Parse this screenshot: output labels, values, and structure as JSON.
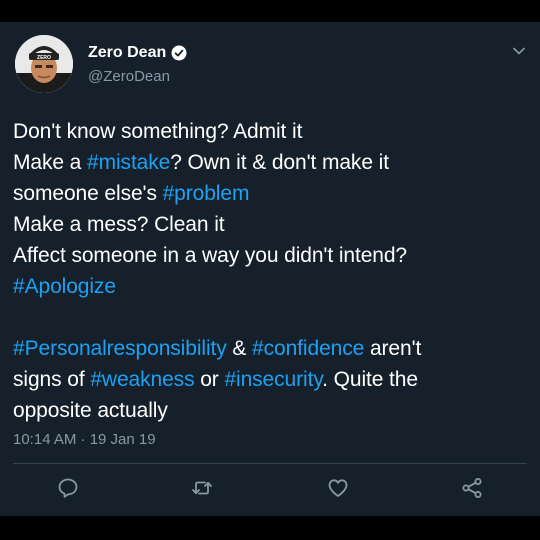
{
  "user": {
    "display_name": "Zero Dean",
    "handle": "@ZeroDean",
    "avatar_cap_text": "ZERO"
  },
  "tweet": {
    "lines": [
      [
        {
          "t": "Don't know something? Admit it"
        }
      ],
      [
        {
          "t": "Make a "
        },
        {
          "t": "#mistake",
          "tag": true
        },
        {
          "t": "? Own it & don't make it"
        }
      ],
      [
        {
          "t": "someone else's "
        },
        {
          "t": "#problem",
          "tag": true
        }
      ],
      [
        {
          "t": "Make a mess? Clean it"
        }
      ],
      [
        {
          "t": "Affect someone in a way you didn't intend?"
        }
      ],
      [
        {
          "t": "#Apologize",
          "tag": true
        }
      ],
      [],
      [
        {
          "t": "#Personalresponsibility",
          "tag": true
        },
        {
          "t": " & "
        },
        {
          "t": "#confidence",
          "tag": true
        },
        {
          "t": " aren't"
        }
      ],
      [
        {
          "t": "signs of "
        },
        {
          "t": "#weakness",
          "tag": true
        },
        {
          "t": " or "
        },
        {
          "t": "#insecurity",
          "tag": true
        },
        {
          "t": ". Quite the"
        }
      ],
      [
        {
          "t": "opposite actually"
        }
      ]
    ],
    "timestamp": "10:14 AM · 19 Jan 19"
  },
  "icons": {
    "verified": "verified-badge-icon",
    "caret": "chevron-down-icon",
    "reply": "reply-icon",
    "retweet": "retweet-icon",
    "like": "heart-icon",
    "share": "share-icon"
  },
  "colors": {
    "background": "#15202b",
    "text": "#ffffff",
    "secondary": "#8899a6",
    "hashtag": "#1da1f2",
    "divider": "#38444d"
  }
}
